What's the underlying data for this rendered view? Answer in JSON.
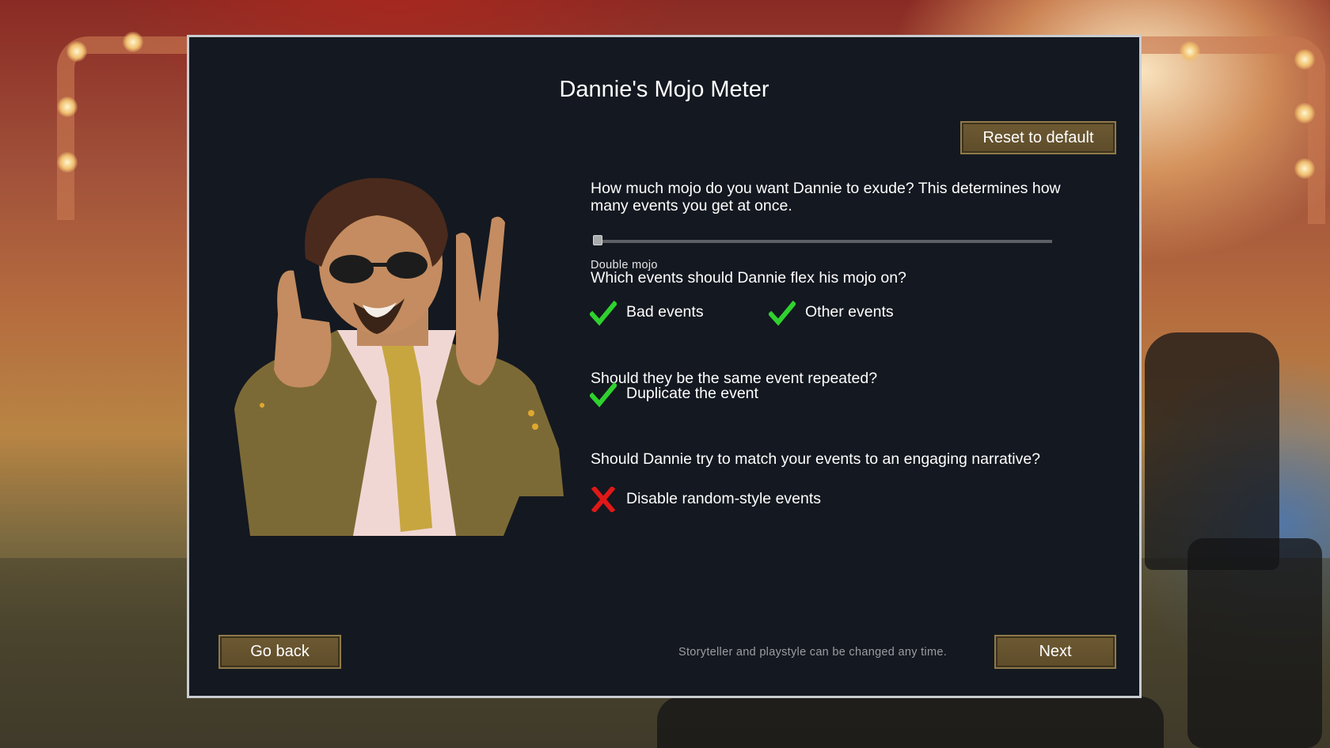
{
  "dialog": {
    "title": "Dannie's Mojo Meter",
    "reset_label": "Reset to default",
    "question_mojo": "How much mojo do you want Dannie to exude? This determines how many events you get at once.",
    "mojo_slider": {
      "value_fraction": 0.0,
      "label": "Double mojo"
    },
    "question_events": "Which events should Dannie flex his mojo on?",
    "options_events": [
      {
        "label": "Bad events",
        "checked": true
      },
      {
        "label": "Other events",
        "checked": true
      }
    ],
    "question_repeat": "Should they be the same event repeated?",
    "option_duplicate": {
      "label": "Duplicate the event",
      "checked": true
    },
    "question_narrative": "Should Dannie try to match your events to an engaging narrative?",
    "option_random": {
      "label": "Disable random-style events",
      "checked": false
    },
    "footnote": "Storyteller and playstyle can be changed any time.",
    "back_label": "Go back",
    "next_label": "Next"
  },
  "icons": {
    "check": "check-icon",
    "cross": "cross-icon",
    "portrait": "storyteller-portrait"
  },
  "colors": {
    "panel_bg": "#141820",
    "button_bg": "#6d5a33",
    "check_green": "#2fd12f",
    "cross_red": "#e01818"
  }
}
